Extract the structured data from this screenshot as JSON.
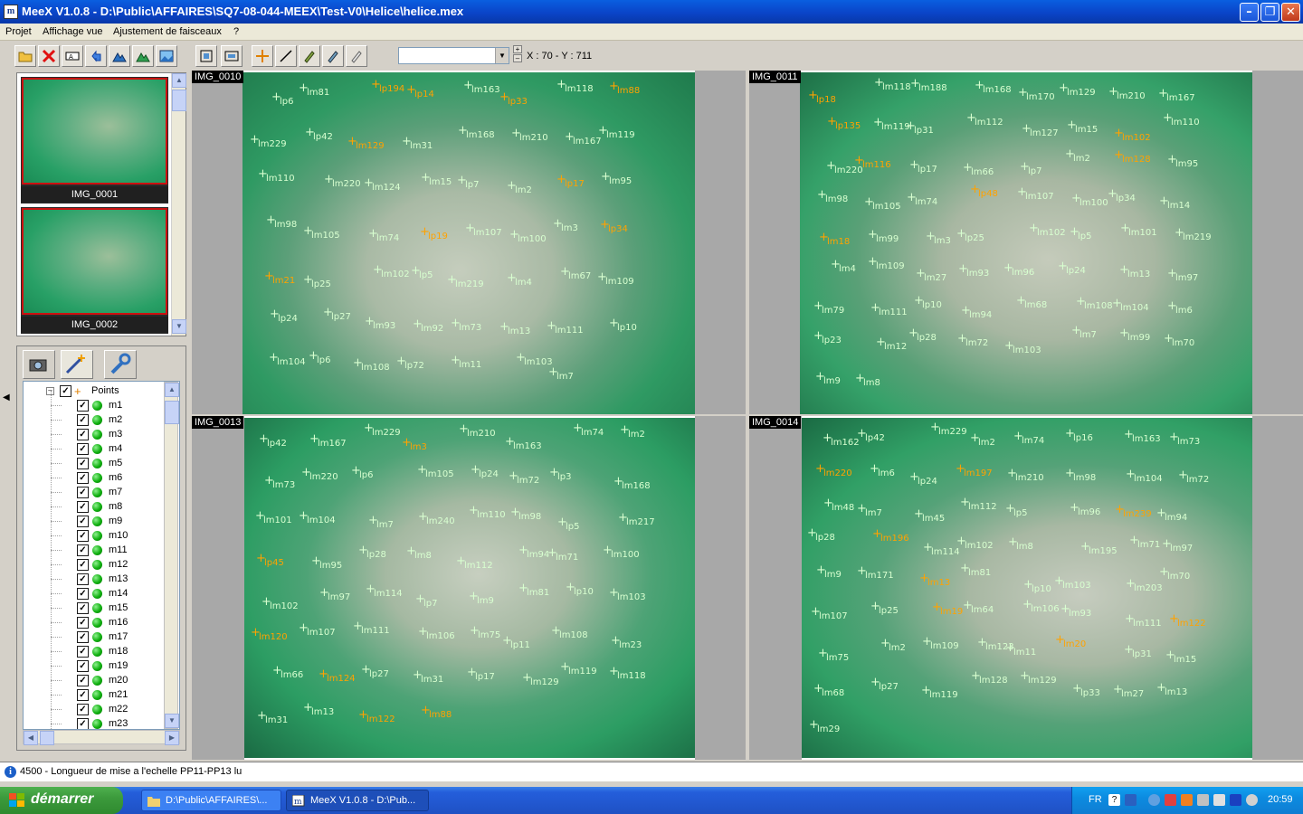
{
  "window": {
    "title": "MeeX V1.0.8 - D:\\Public\\AFFAIRES\\SQ7-08-044-MEEX\\Test-V0\\Helice\\helice.mex",
    "app_icon_text": "m"
  },
  "menu": {
    "items": [
      "Projet",
      "Affichage vue",
      "Ajustement de faisceaux",
      "?"
    ]
  },
  "toolbar": {
    "combo_value": "",
    "coords": "X : 70 - Y : 711"
  },
  "thumbnails": [
    {
      "label": "IMG_0001"
    },
    {
      "label": "IMG_0002"
    }
  ],
  "tree": {
    "root_label": "Points",
    "items": [
      "m1",
      "m2",
      "m3",
      "m4",
      "m5",
      "m6",
      "m7",
      "m8",
      "m9",
      "m10",
      "m11",
      "m12",
      "m13",
      "m14",
      "m15",
      "m16",
      "m17",
      "m18",
      "m19",
      "m20",
      "m21",
      "m22",
      "m23"
    ]
  },
  "views": [
    {
      "label": "IMG_0010",
      "markers": [
        {
          "t": "lp6",
          "c": "g"
        },
        {
          "t": "lm81",
          "c": "g"
        },
        {
          "t": "lp194",
          "c": "o"
        },
        {
          "t": "lp14",
          "c": "o"
        },
        {
          "t": "lm163",
          "c": "g"
        },
        {
          "t": "lp33",
          "c": "o"
        },
        {
          "t": "lm118",
          "c": "g"
        },
        {
          "t": "lm88",
          "c": "o"
        },
        {
          "t": "lm229",
          "c": "g"
        },
        {
          "t": "lp42",
          "c": "g"
        },
        {
          "t": "lm129",
          "c": "o"
        },
        {
          "t": "lm31",
          "c": "g"
        },
        {
          "t": "lm168",
          "c": "g"
        },
        {
          "t": "lm210",
          "c": "g"
        },
        {
          "t": "lm167",
          "c": "g"
        },
        {
          "t": "lm119",
          "c": "g"
        },
        {
          "t": "lm110",
          "c": "g"
        },
        {
          "t": "lm220",
          "c": "g"
        },
        {
          "t": "lm124",
          "c": "g"
        },
        {
          "t": "lm15",
          "c": "g"
        },
        {
          "t": "lp7",
          "c": "g"
        },
        {
          "t": "lm2",
          "c": "g"
        },
        {
          "t": "lp17",
          "c": "o"
        },
        {
          "t": "lm95",
          "c": "g"
        },
        {
          "t": "lm98",
          "c": "g"
        },
        {
          "t": "lm105",
          "c": "g"
        },
        {
          "t": "lm74",
          "c": "g"
        },
        {
          "t": "lp19",
          "c": "o"
        },
        {
          "t": "lm107",
          "c": "g"
        },
        {
          "t": "lm100",
          "c": "g"
        },
        {
          "t": "lm3",
          "c": "g"
        },
        {
          "t": "lp34",
          "c": "o"
        },
        {
          "t": "lm21",
          "c": "o"
        },
        {
          "t": "lp25",
          "c": "g"
        },
        {
          "t": "lm102",
          "c": "g"
        },
        {
          "t": "lp5",
          "c": "g"
        },
        {
          "t": "lm219",
          "c": "g"
        },
        {
          "t": "lm4",
          "c": "g"
        },
        {
          "t": "lm67",
          "c": "g"
        },
        {
          "t": "lm109",
          "c": "g"
        },
        {
          "t": "lp24",
          "c": "g"
        },
        {
          "t": "lp27",
          "c": "g"
        },
        {
          "t": "lm93",
          "c": "g"
        },
        {
          "t": "lm92",
          "c": "g"
        },
        {
          "t": "lm73",
          "c": "g"
        },
        {
          "t": "lm13",
          "c": "g"
        },
        {
          "t": "lm111",
          "c": "g"
        },
        {
          "t": "lp10",
          "c": "g"
        },
        {
          "t": "lm104",
          "c": "g"
        },
        {
          "t": "lp6",
          "c": "g"
        },
        {
          "t": "lm108",
          "c": "g"
        },
        {
          "t": "lp72",
          "c": "g"
        },
        {
          "t": "lm11",
          "c": "g"
        },
        {
          "t": "lm103",
          "c": "g"
        },
        {
          "t": "lm7",
          "c": "g"
        }
      ]
    },
    {
      "label": "IMG_0011",
      "markers": [
        {
          "t": "lp18",
          "c": "o"
        },
        {
          "t": "lm118",
          "c": "g"
        },
        {
          "t": "lm188",
          "c": "g"
        },
        {
          "t": "lm168",
          "c": "g"
        },
        {
          "t": "lm170",
          "c": "g"
        },
        {
          "t": "lm129",
          "c": "g"
        },
        {
          "t": "lm210",
          "c": "g"
        },
        {
          "t": "lm167",
          "c": "g"
        },
        {
          "t": "lp135",
          "c": "o"
        },
        {
          "t": "lm119",
          "c": "g"
        },
        {
          "t": "lp31",
          "c": "g"
        },
        {
          "t": "lm112",
          "c": "g"
        },
        {
          "t": "lm127",
          "c": "g"
        },
        {
          "t": "lm15",
          "c": "g"
        },
        {
          "t": "lm102",
          "c": "o"
        },
        {
          "t": "lm110",
          "c": "g"
        },
        {
          "t": "lm220",
          "c": "g"
        },
        {
          "t": "lm116",
          "c": "o"
        },
        {
          "t": "lp17",
          "c": "g"
        },
        {
          "t": "lm66",
          "c": "g"
        },
        {
          "t": "lp7",
          "c": "g"
        },
        {
          "t": "lm2",
          "c": "g"
        },
        {
          "t": "lm128",
          "c": "o"
        },
        {
          "t": "lm95",
          "c": "g"
        },
        {
          "t": "lm98",
          "c": "g"
        },
        {
          "t": "lm105",
          "c": "g"
        },
        {
          "t": "lm74",
          "c": "g"
        },
        {
          "t": "lp48",
          "c": "o"
        },
        {
          "t": "lm107",
          "c": "g"
        },
        {
          "t": "lm100",
          "c": "g"
        },
        {
          "t": "lp34",
          "c": "g"
        },
        {
          "t": "lm14",
          "c": "g"
        },
        {
          "t": "lm18",
          "c": "o"
        },
        {
          "t": "lm99",
          "c": "g"
        },
        {
          "t": "lm3",
          "c": "g"
        },
        {
          "t": "lp25",
          "c": "g"
        },
        {
          "t": "lm102",
          "c": "g"
        },
        {
          "t": "lp5",
          "c": "g"
        },
        {
          "t": "lm101",
          "c": "g"
        },
        {
          "t": "lm219",
          "c": "g"
        },
        {
          "t": "lm4",
          "c": "g"
        },
        {
          "t": "lm109",
          "c": "g"
        },
        {
          "t": "lm27",
          "c": "g"
        },
        {
          "t": "lm93",
          "c": "g"
        },
        {
          "t": "lm96",
          "c": "g"
        },
        {
          "t": "lp24",
          "c": "g"
        },
        {
          "t": "lm13",
          "c": "g"
        },
        {
          "t": "lm97",
          "c": "g"
        },
        {
          "t": "lm79",
          "c": "g"
        },
        {
          "t": "lm111",
          "c": "g"
        },
        {
          "t": "lp10",
          "c": "g"
        },
        {
          "t": "lm94",
          "c": "g"
        },
        {
          "t": "lm68",
          "c": "g"
        },
        {
          "t": "lm108",
          "c": "g"
        },
        {
          "t": "lm104",
          "c": "g"
        },
        {
          "t": "lm6",
          "c": "g"
        },
        {
          "t": "lp23",
          "c": "g"
        },
        {
          "t": "lm12",
          "c": "g"
        },
        {
          "t": "lp28",
          "c": "g"
        },
        {
          "t": "lm72",
          "c": "g"
        },
        {
          "t": "lm103",
          "c": "g"
        },
        {
          "t": "lm7",
          "c": "g"
        },
        {
          "t": "lm99",
          "c": "g"
        },
        {
          "t": "lm70",
          "c": "g"
        },
        {
          "t": "lm9",
          "c": "g"
        },
        {
          "t": "lm8",
          "c": "g"
        }
      ]
    },
    {
      "label": "IMG_0013",
      "markers": [
        {
          "t": "lp42",
          "c": "g"
        },
        {
          "t": "lm167",
          "c": "g"
        },
        {
          "t": "lm229",
          "c": "g"
        },
        {
          "t": "lm3",
          "c": "o"
        },
        {
          "t": "lm210",
          "c": "g"
        },
        {
          "t": "lm163",
          "c": "g"
        },
        {
          "t": "lm74",
          "c": "g"
        },
        {
          "t": "lm2",
          "c": "g"
        },
        {
          "t": "lm73",
          "c": "g"
        },
        {
          "t": "lm220",
          "c": "g"
        },
        {
          "t": "lp6",
          "c": "g"
        },
        {
          "t": "lm105",
          "c": "g"
        },
        {
          "t": "lp24",
          "c": "g"
        },
        {
          "t": "lm72",
          "c": "g"
        },
        {
          "t": "lp3",
          "c": "g"
        },
        {
          "t": "lm168",
          "c": "g"
        },
        {
          "t": "lm101",
          "c": "g"
        },
        {
          "t": "lm104",
          "c": "g"
        },
        {
          "t": "lm7",
          "c": "g"
        },
        {
          "t": "lm240",
          "c": "g"
        },
        {
          "t": "lm110",
          "c": "g"
        },
        {
          "t": "lm98",
          "c": "g"
        },
        {
          "t": "lp5",
          "c": "g"
        },
        {
          "t": "lm217",
          "c": "g"
        },
        {
          "t": "lp45",
          "c": "o"
        },
        {
          "t": "lm95",
          "c": "g"
        },
        {
          "t": "lp28",
          "c": "g"
        },
        {
          "t": "lm8",
          "c": "g"
        },
        {
          "t": "lm112",
          "c": "g"
        },
        {
          "t": "lm94",
          "c": "g"
        },
        {
          "t": "lm71",
          "c": "g"
        },
        {
          "t": "lm100",
          "c": "g"
        },
        {
          "t": "lm102",
          "c": "g"
        },
        {
          "t": "lm97",
          "c": "g"
        },
        {
          "t": "lm114",
          "c": "g"
        },
        {
          "t": "lp7",
          "c": "g"
        },
        {
          "t": "lm9",
          "c": "g"
        },
        {
          "t": "lm81",
          "c": "g"
        },
        {
          "t": "lp10",
          "c": "g"
        },
        {
          "t": "lm103",
          "c": "g"
        },
        {
          "t": "lm120",
          "c": "o"
        },
        {
          "t": "lm107",
          "c": "g"
        },
        {
          "t": "lm111",
          "c": "g"
        },
        {
          "t": "lm106",
          "c": "g"
        },
        {
          "t": "lm75",
          "c": "g"
        },
        {
          "t": "lp11",
          "c": "g"
        },
        {
          "t": "lm108",
          "c": "g"
        },
        {
          "t": "lm23",
          "c": "g"
        },
        {
          "t": "lm66",
          "c": "g"
        },
        {
          "t": "lm124",
          "c": "o"
        },
        {
          "t": "lp27",
          "c": "g"
        },
        {
          "t": "lm31",
          "c": "g"
        },
        {
          "t": "lp17",
          "c": "g"
        },
        {
          "t": "lm129",
          "c": "g"
        },
        {
          "t": "lm119",
          "c": "g"
        },
        {
          "t": "lm118",
          "c": "g"
        },
        {
          "t": "lm31",
          "c": "g"
        },
        {
          "t": "lm13",
          "c": "g"
        },
        {
          "t": "lm122",
          "c": "o"
        },
        {
          "t": "lm88",
          "c": "o"
        }
      ]
    },
    {
      "label": "IMG_0014",
      "markers": [
        {
          "t": "lm162",
          "c": "g"
        },
        {
          "t": "lp42",
          "c": "g"
        },
        {
          "t": "lm229",
          "c": "g"
        },
        {
          "t": "lm2",
          "c": "g"
        },
        {
          "t": "lm74",
          "c": "g"
        },
        {
          "t": "lp16",
          "c": "g"
        },
        {
          "t": "lm163",
          "c": "g"
        },
        {
          "t": "lm73",
          "c": "g"
        },
        {
          "t": "lm220",
          "c": "o"
        },
        {
          "t": "lm6",
          "c": "g"
        },
        {
          "t": "lp24",
          "c": "g"
        },
        {
          "t": "lm197",
          "c": "o"
        },
        {
          "t": "lm210",
          "c": "g"
        },
        {
          "t": "lm98",
          "c": "g"
        },
        {
          "t": "lm104",
          "c": "g"
        },
        {
          "t": "lm72",
          "c": "g"
        },
        {
          "t": "lm48",
          "c": "g"
        },
        {
          "t": "lm7",
          "c": "g"
        },
        {
          "t": "lm45",
          "c": "g"
        },
        {
          "t": "lm112",
          "c": "g"
        },
        {
          "t": "lp5",
          "c": "g"
        },
        {
          "t": "lm96",
          "c": "g"
        },
        {
          "t": "lm239",
          "c": "o"
        },
        {
          "t": "lm94",
          "c": "g"
        },
        {
          "t": "lp28",
          "c": "g"
        },
        {
          "t": "lm196",
          "c": "o"
        },
        {
          "t": "lm114",
          "c": "g"
        },
        {
          "t": "lm102",
          "c": "g"
        },
        {
          "t": "lm8",
          "c": "g"
        },
        {
          "t": "lm195",
          "c": "g"
        },
        {
          "t": "lm71",
          "c": "g"
        },
        {
          "t": "lm97",
          "c": "g"
        },
        {
          "t": "lm9",
          "c": "g"
        },
        {
          "t": "lm171",
          "c": "g"
        },
        {
          "t": "lm13",
          "c": "o"
        },
        {
          "t": "lm81",
          "c": "g"
        },
        {
          "t": "lp10",
          "c": "g"
        },
        {
          "t": "lm103",
          "c": "g"
        },
        {
          "t": "lm203",
          "c": "g"
        },
        {
          "t": "lm70",
          "c": "g"
        },
        {
          "t": "lm107",
          "c": "g"
        },
        {
          "t": "lp25",
          "c": "g"
        },
        {
          "t": "lm19",
          "c": "o"
        },
        {
          "t": "lm64",
          "c": "g"
        },
        {
          "t": "lm106",
          "c": "g"
        },
        {
          "t": "lm93",
          "c": "g"
        },
        {
          "t": "lm111",
          "c": "g"
        },
        {
          "t": "lm122",
          "c": "o"
        },
        {
          "t": "lm75",
          "c": "g"
        },
        {
          "t": "lm2",
          "c": "g"
        },
        {
          "t": "lm109",
          "c": "g"
        },
        {
          "t": "lm123",
          "c": "g"
        },
        {
          "t": "lm11",
          "c": "g"
        },
        {
          "t": "lm20",
          "c": "o"
        },
        {
          "t": "lp31",
          "c": "g"
        },
        {
          "t": "lm15",
          "c": "g"
        },
        {
          "t": "lm68",
          "c": "g"
        },
        {
          "t": "lp27",
          "c": "g"
        },
        {
          "t": "lm119",
          "c": "g"
        },
        {
          "t": "lm128",
          "c": "g"
        },
        {
          "t": "lm129",
          "c": "g"
        },
        {
          "t": "lp33",
          "c": "g"
        },
        {
          "t": "lm27",
          "c": "g"
        },
        {
          "t": "lm13",
          "c": "g"
        },
        {
          "t": "lm29",
          "c": "g"
        }
      ]
    }
  ],
  "status": {
    "message": "4500 - Longueur de mise a l'echelle PP11-PP13 lu"
  },
  "taskbar": {
    "start_label": "démarrer",
    "tasks": [
      {
        "label": "D:\\Public\\AFFAIRES\\..."
      },
      {
        "label": "MeeX V1.0.8 - D:\\Pub..."
      }
    ],
    "lang": "FR",
    "clock": "20:59"
  },
  "colors": {
    "titlebar": "#0a50d8",
    "marker_green": "#d8ffd0",
    "marker_orange": "#ffa200",
    "thumb_border": "#cc1010",
    "taskbar": "#245edb",
    "start_button": "#3c9a3c"
  }
}
